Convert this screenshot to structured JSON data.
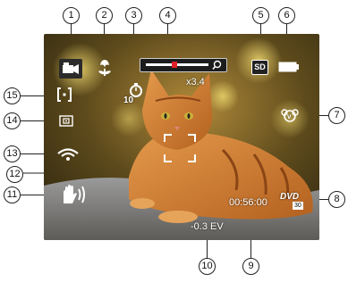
{
  "callouts": [
    "1",
    "2",
    "3",
    "4",
    "5",
    "6",
    "7",
    "8",
    "9",
    "10",
    "11",
    "12",
    "13",
    "14",
    "15"
  ],
  "osd": {
    "zoom_label": "x3.4",
    "zoom_level": 0.45,
    "self_timer_value": "10",
    "storage_label": "SD",
    "video_quality_label": "DVD",
    "video_quality_sub": "30",
    "recording_time": "00:56:00",
    "exposure_value": "-0.3 EV"
  },
  "icons": {
    "video_mode": "video-camera-icon",
    "macro": "flower-macro-icon",
    "self_timer": "self-timer-icon",
    "zoom": "zoom-bar-icon",
    "storage": "sd-card-icon",
    "battery": "battery-icon",
    "color_mode": "vivid-color-icon",
    "video_quality": "dvd-quality-icon",
    "anti_shake": "anti-shake-hand-icon",
    "focus_frame": "focus-frame-icon",
    "wifi": "wifi-icon",
    "metering": "metering-icon",
    "af_mode": "af-mode-icon"
  },
  "colors": {
    "osd_text": "#ffffff",
    "zoom_marker": "#e0202a",
    "callout_border": "#222222"
  }
}
